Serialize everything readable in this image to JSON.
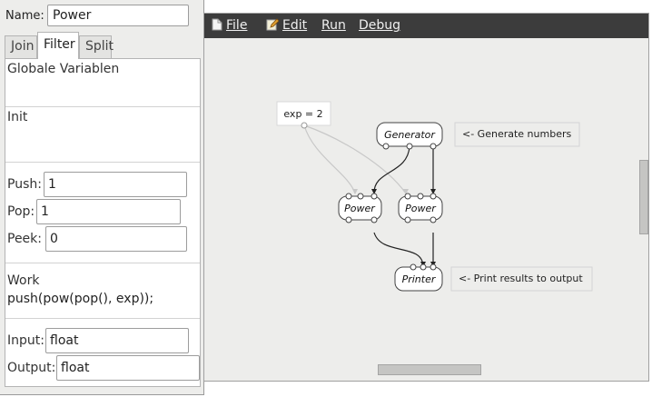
{
  "properties": {
    "name_label": "Name:",
    "name_value": "Power",
    "tabs": [
      {
        "label": "Join"
      },
      {
        "label": "Filter",
        "active": true
      },
      {
        "label": "Split"
      }
    ],
    "sections": {
      "globals_title": "Globale Variablen",
      "init_title": "Init",
      "push_label": "Push:",
      "push_value": "1",
      "pop_label": "Pop:",
      "pop_value": "1",
      "peek_label": "Peek:",
      "peek_value": "0",
      "work_title": "Work",
      "work_code": "push(pow(pop(), exp));",
      "input_label": "Input:",
      "input_value": "float",
      "output_label": "Output:",
      "output_value": "float"
    }
  },
  "menubar": {
    "items": [
      {
        "label": "File",
        "icon": "file-icon"
      },
      {
        "label": "Edit",
        "icon": "edit-icon"
      },
      {
        "label": "Run"
      },
      {
        "label": "Debug"
      }
    ]
  },
  "graph": {
    "variable": "exp = 2",
    "nodes": {
      "generator": "Generator",
      "power_a": "Power",
      "power_b": "Power",
      "printer": "Printer"
    },
    "comments": {
      "generate": "<- Generate numbers",
      "print": "<- Print results to output"
    }
  },
  "colors": {
    "menubar": "#3c3c3c",
    "panel": "#ededeb",
    "edge": "#222222",
    "var_edge": "#c8c8c8"
  }
}
